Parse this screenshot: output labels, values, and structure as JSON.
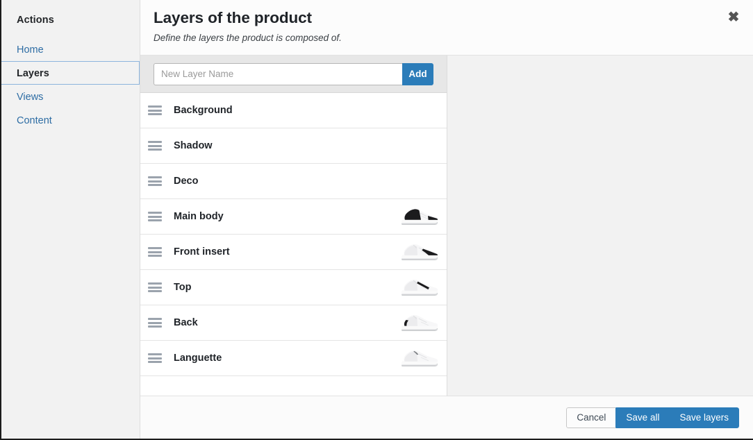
{
  "sidebar": {
    "title": "Actions",
    "items": [
      {
        "label": "Home",
        "active": false
      },
      {
        "label": "Layers",
        "active": true
      },
      {
        "label": "Views",
        "active": false
      },
      {
        "label": "Content",
        "active": false
      }
    ]
  },
  "modal": {
    "title": "Layers of the product",
    "subtitle": "Define the layers the product is composed of.",
    "close_icon": "close-icon",
    "close_glyph": "✖"
  },
  "add_layer": {
    "placeholder": "New Layer Name",
    "value": "",
    "button_label": "Add"
  },
  "layers": {
    "drag_handle_icon": "drag-handle-icon",
    "items": [
      {
        "name": "Background",
        "has_thumbnail": false,
        "thumbnail": "none"
      },
      {
        "name": "Shadow",
        "has_thumbnail": false,
        "thumbnail": "none"
      },
      {
        "name": "Deco",
        "has_thumbnail": false,
        "thumbnail": "none"
      },
      {
        "name": "Main body",
        "has_thumbnail": true,
        "thumbnail": "sneaker-black-upper"
      },
      {
        "name": "Front insert",
        "has_thumbnail": true,
        "thumbnail": "sneaker-black-swoosh"
      },
      {
        "name": "Top",
        "has_thumbnail": true,
        "thumbnail": "sneaker-black-lace-stripe"
      },
      {
        "name": "Back",
        "has_thumbnail": true,
        "thumbnail": "sneaker-black-heel"
      },
      {
        "name": "Languette",
        "has_thumbnail": true,
        "thumbnail": "sneaker-white-tongue"
      },
      {
        "name": "",
        "has_thumbnail": false,
        "thumbnail": "none"
      }
    ]
  },
  "footer": {
    "cancel_label": "Cancel",
    "save_all_label": "Save all",
    "save_layers_label": "Save layers"
  },
  "colors": {
    "accent": "#2b7cb9",
    "sidebar_bg": "#f2f2f2",
    "active_border": "#8cb4dd",
    "link": "#2e6da4",
    "text": "#1f2328",
    "panel_bg": "#f2f2f2",
    "addbar_bg": "#e7e7e7"
  }
}
